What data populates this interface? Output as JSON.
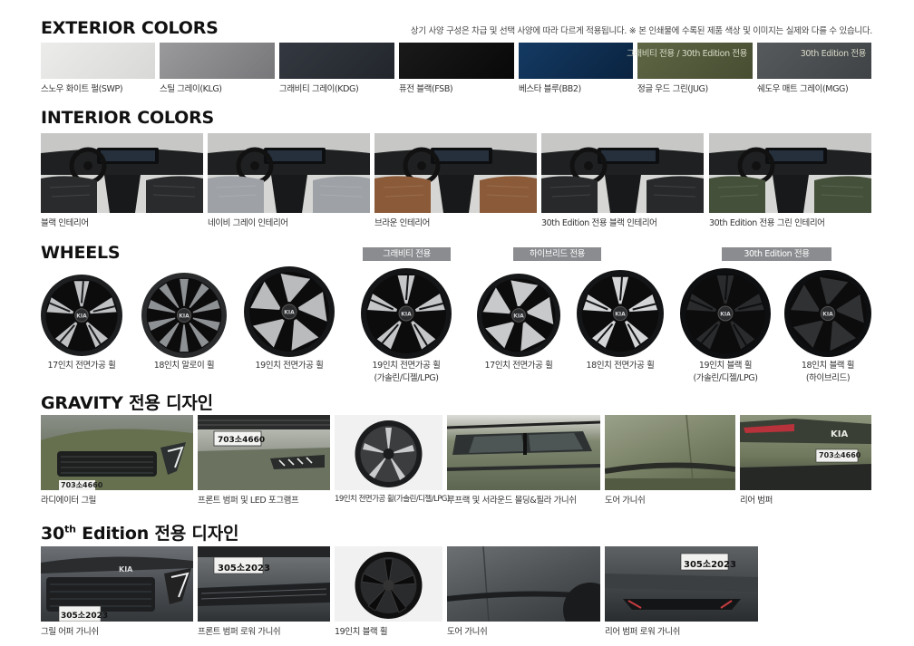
{
  "disclaimer": "상기 사양 구성은 차급 및 선택 사양에 따라 다르게 적용됩니다. ※ 본 인쇄물에 수록된 제품 색상 및 이미지는 실제와 다를 수 있습니다.",
  "exterior": {
    "title": "EXTERIOR COLORS",
    "colors": [
      {
        "label": "스노우 화이트 펄(SWP)",
        "color": "#e4e4e2"
      },
      {
        "label": "스틸 그레이(KLG)",
        "color": "#8a8a8c"
      },
      {
        "label": "그래비티 그레이(KDG)",
        "color": "#2b2f36"
      },
      {
        "label": "퓨전 블랙(FSB)",
        "color": "#101010"
      },
      {
        "label": "베스타 블루(BB2)",
        "color": "#0d2c4f"
      },
      {
        "label": "정글 우드 그린(JUG)",
        "color": "#545b3c",
        "tag": "그래비티 전용 / 30th Edition 전용"
      },
      {
        "label": "쉐도우 매트 그레이(MGG)",
        "color": "#4b4f52",
        "tag": "30th Edition 전용"
      }
    ]
  },
  "interior": {
    "title": "INTERIOR COLORS",
    "items": [
      {
        "label": "블랙 인테리어",
        "seat": "#2a2b2c"
      },
      {
        "label": "네이비 그레이 인테리어",
        "seat": "#9ea2a6"
      },
      {
        "label": "브라운 인테리어",
        "seat": "#8b5a38"
      },
      {
        "label": "30th Edition 전용 블랙 인테리어",
        "seat": "#27292a"
      },
      {
        "label": "30th Edition 전용 그린 인테리어",
        "seat": "#44503a"
      }
    ]
  },
  "wheels": {
    "title": "WHEELS",
    "badges": [
      "그래비티 전용",
      "하이브리드 전용",
      "30th Edition 전용"
    ],
    "items": [
      {
        "line1": "17인치 전면가공 휠",
        "line2": ""
      },
      {
        "line1": "18인치 알로이 휠",
        "line2": ""
      },
      {
        "line1": "19인치 전면가공 휠",
        "line2": ""
      },
      {
        "line1": "19인치 전면가공 휠",
        "line2": "(가솔린/디젤/LPG)"
      },
      {
        "line1": "17인치 전면가공 휠",
        "line2": ""
      },
      {
        "line1": "18인치 전면가공 휠",
        "line2": ""
      },
      {
        "line1": "19인치 블랙 휠",
        "line2": "(가솔린/디젤/LPG)"
      },
      {
        "line1": "18인치 블랙 휠",
        "line2": "(하이브리드)"
      }
    ]
  },
  "gravity": {
    "title": "GRAVITY 전용 디자인",
    "plate": "703소4660",
    "items": [
      "라디에이터 그릴",
      "프론트 범퍼 및 LED 포그램프",
      "19인치 전면가공 휠(가솔린/디젤/LPG)",
      "루프랙 및 서라운드 몰딩&필라 가니쉬",
      "도어 가니쉬",
      "리어 범퍼"
    ]
  },
  "edition30": {
    "title_main": "30",
    "title_sup": "th",
    "title_rest": " Edition 전용 디자인",
    "plate": "305소2023",
    "items": [
      "그릴 어퍼 가니쉬",
      "프론트 범퍼 로워 가니쉬",
      "19인치 블랙 휠",
      "도어 가니쉬",
      "리어 범퍼 로워 가니쉬"
    ]
  }
}
